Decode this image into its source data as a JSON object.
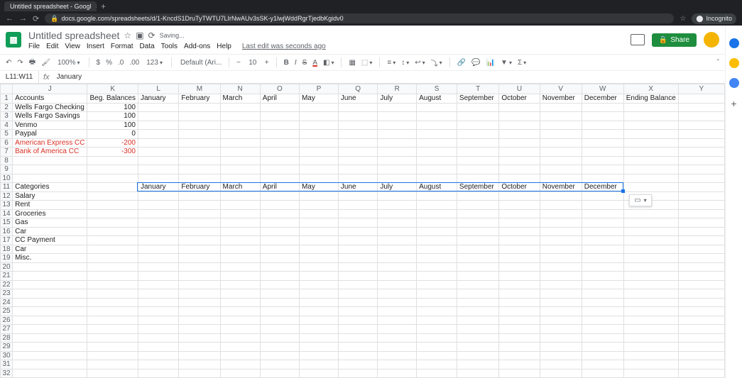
{
  "browser": {
    "tab_title": "Untitled spreadsheet - Googl",
    "url": "docs.google.com/spreadsheets/d/1-KncdS1DruTyTWTU7LIrNwAUv3sSK-y1lwjWddRgrTjedbKgidv0",
    "incognito": "Incognito"
  },
  "doc": {
    "title": "Untitled spreadsheet",
    "saving": "Saving...",
    "last_edit": "Last edit was seconds ago",
    "menus": [
      "File",
      "Edit",
      "View",
      "Insert",
      "Format",
      "Data",
      "Tools",
      "Add-ons",
      "Help"
    ],
    "share": "Share"
  },
  "toolbar": {
    "zoom": "100%",
    "currency": "$",
    "percent": "%",
    "dec_dec": ".0",
    "inc_dec": ".00",
    "more_fmt": "123",
    "font": "Default (Ari...",
    "size": "10",
    "b": "B",
    "i": "I",
    "s": "S",
    "a": "A"
  },
  "fx": {
    "namebox": "L11:W11",
    "label": "fx",
    "formula": "January"
  },
  "columns": [
    "J",
    "K",
    "L",
    "M",
    "N",
    "O",
    "P",
    "Q",
    "R",
    "S",
    "T",
    "U",
    "V",
    "W",
    "X",
    "Y"
  ],
  "months": [
    "January",
    "February",
    "March",
    "April",
    "May",
    "June",
    "July",
    "August",
    "September",
    "October",
    "November",
    "December"
  ],
  "header_row": {
    "accounts": "Accounts",
    "beg": "Beg. Balances",
    "ending": "Ending Balance"
  },
  "accounts": [
    {
      "name": "Wells Fargo Checking",
      "bal": "100",
      "red": false
    },
    {
      "name": "Wells Fargo Savings",
      "bal": "100",
      "red": false
    },
    {
      "name": "Venmo",
      "bal": "100",
      "red": false
    },
    {
      "name": "Paypal",
      "bal": "0",
      "red": false
    },
    {
      "name": "American Express CC",
      "bal": "-200",
      "red": true
    },
    {
      "name": "Bank of America CC",
      "bal": "-300",
      "red": true
    }
  ],
  "categories_label": "Categories",
  "categories": [
    "Salary",
    "Rent",
    "Groceries",
    "Gas",
    "Car",
    "CC Payment",
    "Car",
    "Misc."
  ],
  "selection": {
    "row": 11,
    "startCol": "L",
    "endCol": "W"
  }
}
